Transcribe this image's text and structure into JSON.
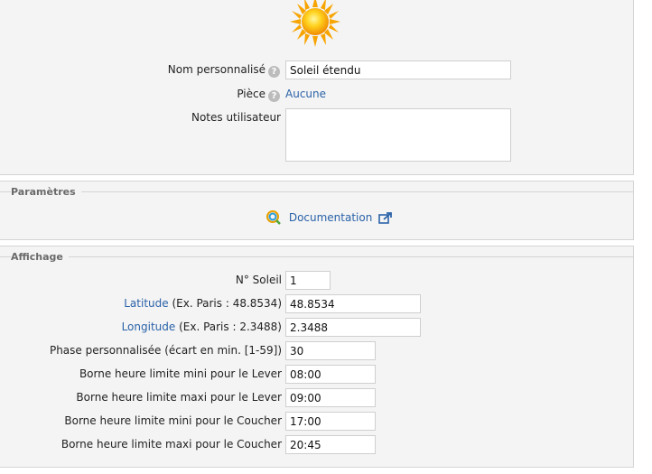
{
  "header": {
    "icon": "sun-icon"
  },
  "general": {
    "nom_label": "Nom personnalisé",
    "nom_value": "Soleil étendu",
    "piece_label": "Pièce",
    "piece_value": "Aucune",
    "notes_label": "Notes utilisateur",
    "notes_value": "",
    "help_icon": "question-icon"
  },
  "parametres": {
    "legend": "Paramètres",
    "doc_label": "Documentation",
    "doc_icon": "search-doc-icon",
    "ext_icon": "external-link-icon"
  },
  "affichage": {
    "legend": "Affichage",
    "fields": [
      {
        "label": "N° Soleil",
        "value": "1"
      },
      {
        "label_link": "Latitude",
        "label_rest": " (Ex. Paris : 48.8534)",
        "value": "48.8534"
      },
      {
        "label_link": "Longitude",
        "label_rest": " (Ex. Paris : 2.3488)",
        "value": "2.3488"
      },
      {
        "label": "Phase personnalisée (écart en min. [1-59])",
        "value": "30"
      },
      {
        "label": "Borne heure limite mini pour le Lever",
        "value": "08:00"
      },
      {
        "label": "Borne heure limite maxi pour le Lever",
        "value": "09:00"
      },
      {
        "label": "Borne heure limite mini pour le Coucher",
        "value": "17:00"
      },
      {
        "label": "Borne heure limite maxi pour le Coucher",
        "value": "20:45"
      }
    ]
  },
  "colors": {
    "link": "#2a62a8",
    "panel_bg": "#f4f4f4",
    "border": "#d4d4d4"
  }
}
